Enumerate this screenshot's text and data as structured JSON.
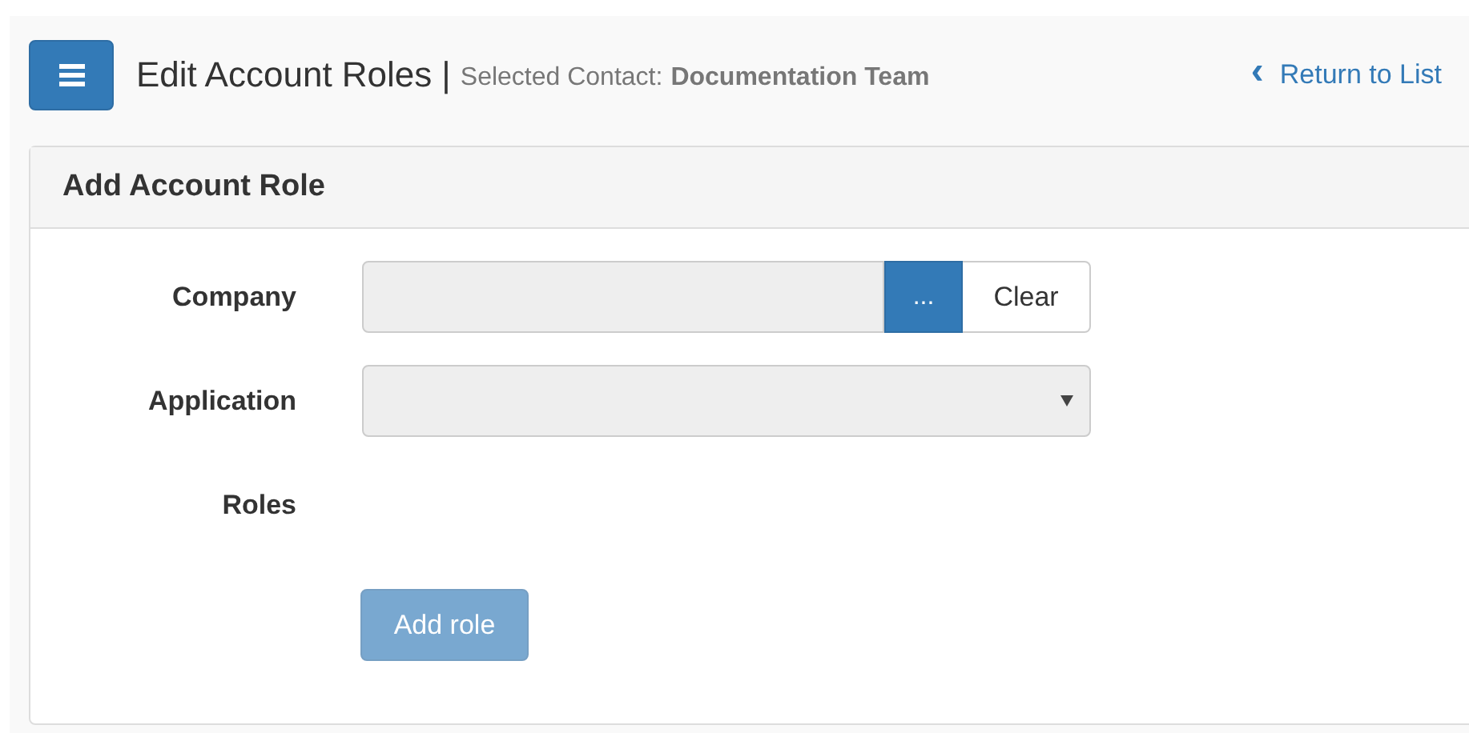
{
  "header": {
    "title": "Edit Account Roles",
    "separator": "|",
    "subtitle_label": "Selected Contact:",
    "subtitle_value": "Documentation Team",
    "return_link": {
      "icon": "‹",
      "label": "Return to List"
    }
  },
  "panel": {
    "title": "Add Account Role",
    "fields": [
      {
        "kind": "lookup",
        "label": "Company",
        "disabled": true,
        "browse_label": "...",
        "clear_label": "Clear"
      },
      {
        "kind": "select",
        "label": "Application",
        "disabled": true
      },
      {
        "kind": "roles",
        "label": "Roles"
      }
    ],
    "add_button": {
      "label": "Add role",
      "disabled": true
    }
  }
}
